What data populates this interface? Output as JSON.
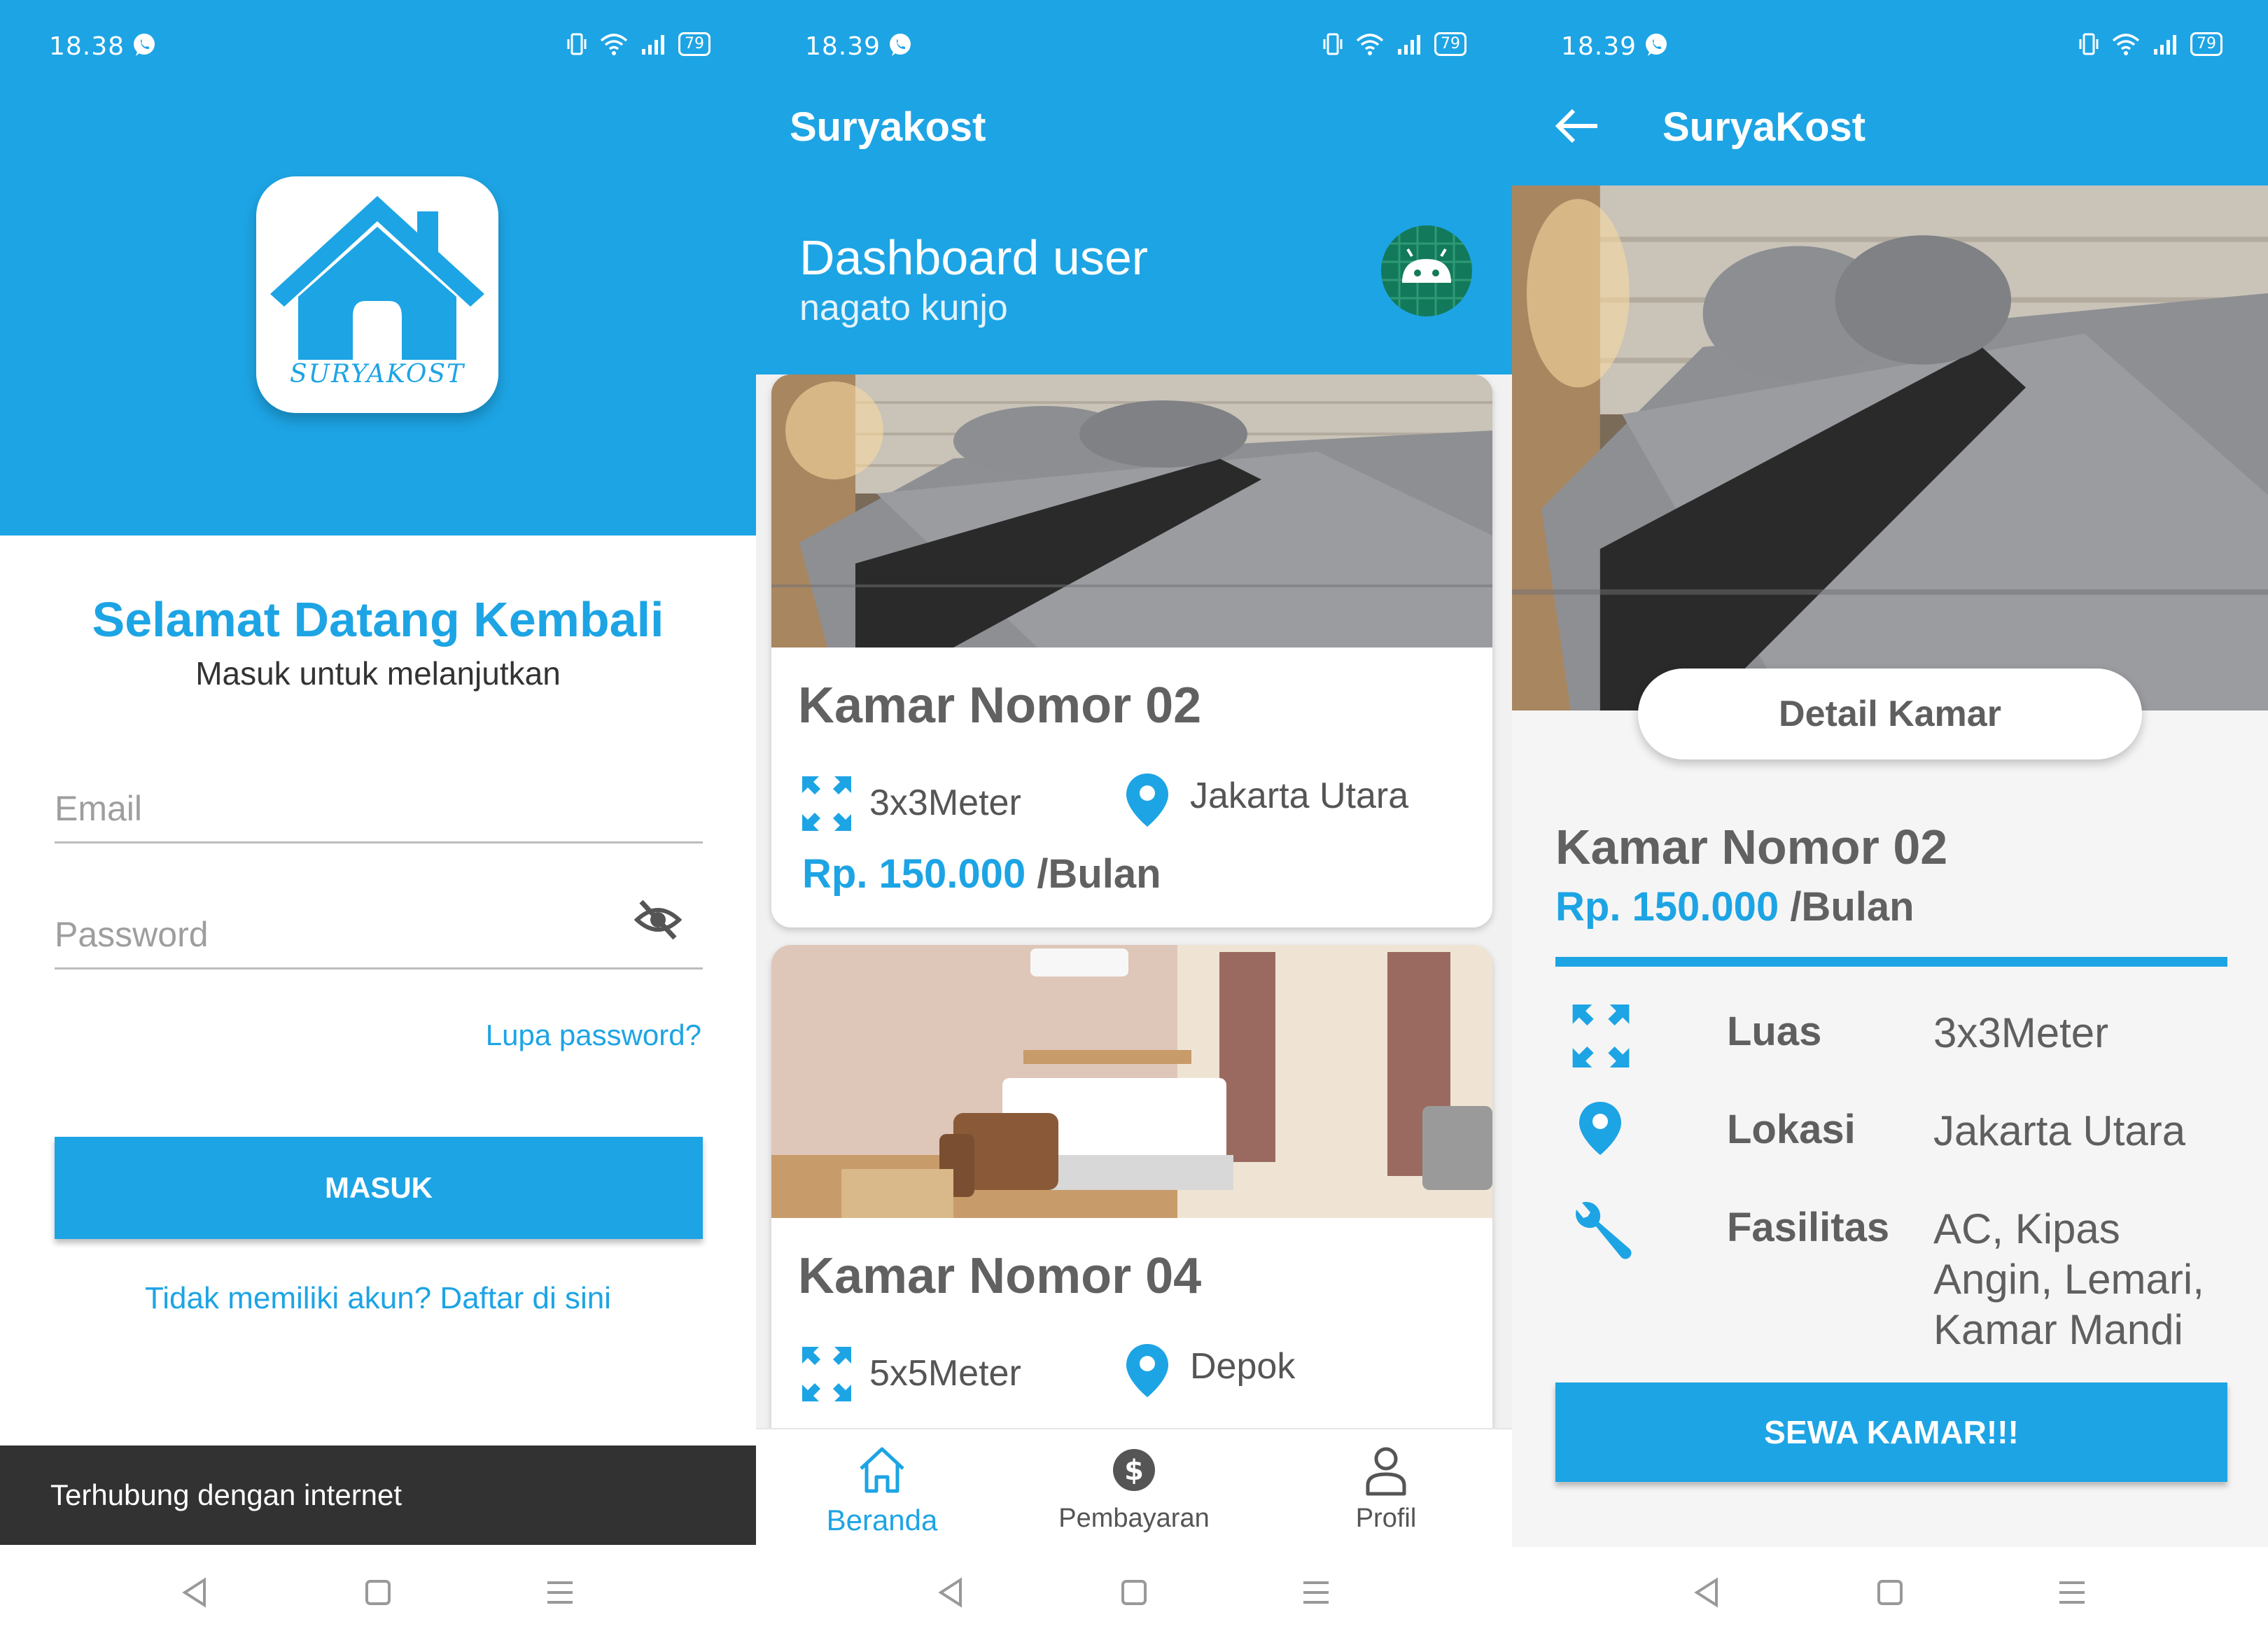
{
  "colors": {
    "accent": "#1da4e4",
    "dark_text": "#616161",
    "snackbar": "#323232"
  },
  "screen1": {
    "status": {
      "time": "18.38",
      "battery": "79"
    },
    "logo_text": "SURYAKOST",
    "title": "Selamat Datang Kembali",
    "subtitle": "Masuk untuk melanjutkan",
    "email_placeholder": "Email",
    "password_placeholder": "Password",
    "forgot_password": "Lupa password?",
    "login_button": "MASUK",
    "register_link": "Tidak memiliki akun? Daftar di sini",
    "snackbar": "Terhubung dengan internet"
  },
  "screen2": {
    "status": {
      "time": "18.39",
      "battery": "79"
    },
    "app_title": "Suryakost",
    "dashboard_title": "Dashboard user",
    "username": "nagato kunjo",
    "rooms": [
      {
        "name": "Kamar Nomor 02",
        "size": "3x3Meter",
        "location": "Jakarta Utara",
        "price": "Rp. 150.000",
        "period": " /Bulan"
      },
      {
        "name": "Kamar Nomor 04",
        "size": "5x5Meter",
        "location": "Depok"
      }
    ],
    "bottom_nav": [
      {
        "label": "Beranda",
        "icon": "home-icon",
        "active": true
      },
      {
        "label": "Pembayaran",
        "icon": "dollar-icon",
        "active": false
      },
      {
        "label": "Profil",
        "icon": "person-icon",
        "active": false
      }
    ]
  },
  "screen3": {
    "status": {
      "time": "18.39",
      "battery": "79"
    },
    "app_title": "SuryaKost",
    "detail_pill": "Detail Kamar",
    "room_name": "Kamar Nomor 02",
    "price": "Rp. 150.000",
    "period": " /Bulan",
    "details": [
      {
        "label": "Luas",
        "value": "3x3Meter",
        "icon": "expand-icon"
      },
      {
        "label": "Lokasi",
        "value": "Jakarta Utara",
        "icon": "location-pin-icon"
      },
      {
        "label": "Fasilitas",
        "value": "AC, Kipas Angin, Lemari, Kamar Mandi",
        "icon": "wrench-icon"
      }
    ],
    "rent_button": "SEWA KAMAR!!!"
  }
}
